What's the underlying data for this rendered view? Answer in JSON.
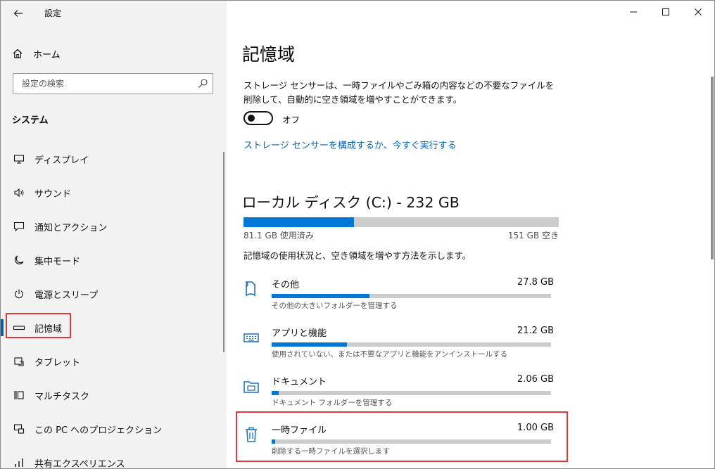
{
  "titlebar": {
    "back_icon": "arrow-left-icon",
    "title": "設定",
    "controls": [
      "minimize",
      "maximize",
      "close"
    ]
  },
  "sidebar": {
    "home_label": "ホーム",
    "search_placeholder": "設定の検索",
    "section_label": "システム",
    "items": [
      {
        "label": "ディスプレイ",
        "icon": "monitor-icon"
      },
      {
        "label": "サウンド",
        "icon": "speaker-icon"
      },
      {
        "label": "通知とアクション",
        "icon": "message-icon"
      },
      {
        "label": "集中モード",
        "icon": "moon-icon"
      },
      {
        "label": "電源とスリープ",
        "icon": "power-icon"
      },
      {
        "label": "記憶域",
        "icon": "drive-icon",
        "active": true
      },
      {
        "label": "タブレット",
        "icon": "tablet-icon"
      },
      {
        "label": "マルチタスク",
        "icon": "multitask-icon"
      },
      {
        "label": "この PC へのプロジェクション",
        "icon": "projection-icon"
      },
      {
        "label": "共有エクスペリエンス",
        "icon": "shared-icon"
      }
    ]
  },
  "main": {
    "title": "記憶域",
    "description": "ストレージ センサーは、一時ファイルやごみ箱の内容などの不要なファイルを削除して、自動的に空き領域を増やすことができます。",
    "toggle": {
      "state": "off",
      "label": "オフ"
    },
    "configure_link": "ストレージ センサーを構成するか、今すぐ実行する",
    "disk": {
      "title": "ローカル ディスク (C:) - 232 GB",
      "used_label": "81.1 GB 使用済み",
      "free_label": "151 GB 空き",
      "used_fraction": 0.35
    },
    "usage_description": "記憶域の使用状況と、空き領域を増やす方法を示します。",
    "categories": [
      {
        "name": "その他",
        "size": "27.8 GB",
        "desc": "その他の大きいフォルダーを管理する",
        "icon": "folder-document-icon",
        "fraction": 0.35
      },
      {
        "name": "アプリと機能",
        "size": "21.2 GB",
        "desc": "使用されていない、または不要なアプリと機能をアンインストールする",
        "icon": "keyboard-icon",
        "fraction": 0.27
      },
      {
        "name": "ドキュメント",
        "size": "2.06 GB",
        "desc": "ドキュメント フォルダーを管理する",
        "icon": "folder-icon",
        "fraction": 0.025
      },
      {
        "name": "一時ファイル",
        "size": "1.00 GB",
        "desc": "削除する一時ファイルを選択します",
        "icon": "trash-icon",
        "fraction": 0.012
      }
    ]
  },
  "colors": {
    "accent": "#0078d7",
    "link": "#0067c0",
    "highlight": "#e0383b"
  }
}
